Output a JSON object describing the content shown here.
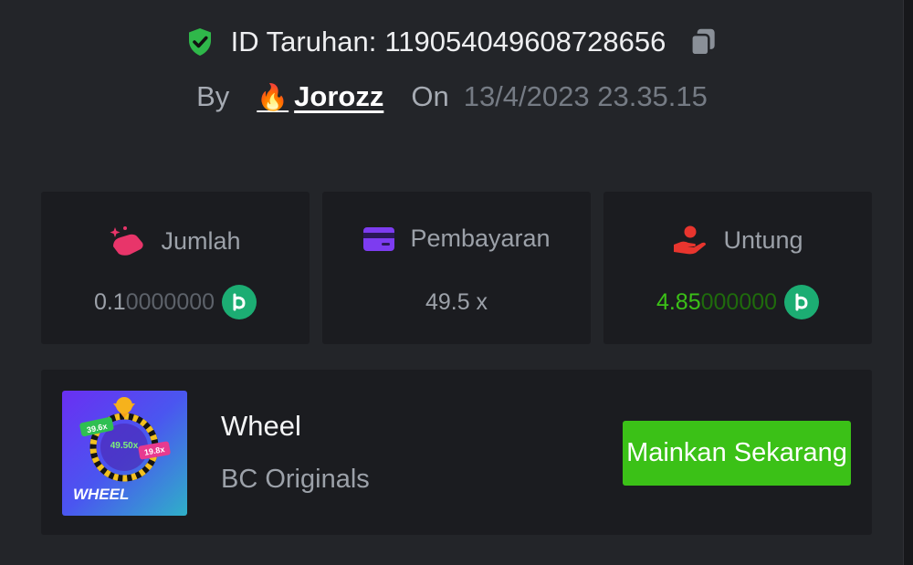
{
  "bet": {
    "id_label": "ID Taruhan:",
    "id_value": "119054049608728656",
    "by_label": "By",
    "user_emoji": "🔥",
    "username": "Jorozz",
    "on_label": "On",
    "date": "13/4/2023 23.35.15"
  },
  "stats": {
    "amount": {
      "label": "Jumlah",
      "value_main": "0.1",
      "value_dim": "0000000",
      "icon": "bet-amount-icon"
    },
    "payout": {
      "label": "Pembayaran",
      "value": "49.5 x",
      "icon": "card-icon"
    },
    "profit": {
      "label": "Untung",
      "value_main": "4.85",
      "value_dim": "000000",
      "icon": "hand-profit-icon"
    }
  },
  "game": {
    "thumb_title": "WHEEL",
    "thumb_badges": [
      "39.6x",
      "49.50x",
      "19.8x"
    ],
    "title": "Wheel",
    "provider": "BC Originals",
    "play_label": "Mainkan Sekarang"
  },
  "colors": {
    "accent_green": "#3bc117",
    "coin_green": "#1cad73",
    "panel_bg": "#232529",
    "card_bg": "#1b1c20"
  }
}
